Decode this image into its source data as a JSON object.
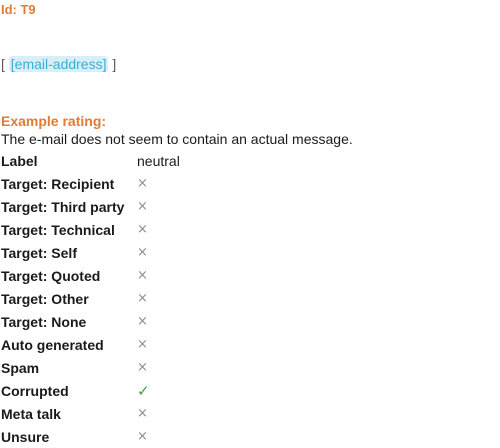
{
  "id_line": "Id: T9",
  "email": {
    "open": "[ ",
    "tag": "[email-address]",
    "close": " ]"
  },
  "example_title": "Example rating:",
  "description": "The e-mail does not seem to contain an actual message.",
  "label_row": {
    "key": "Label",
    "value": "neutral"
  },
  "symbols": {
    "no": "×",
    "yes": "✓"
  },
  "colors": {
    "orange": "#e07b39",
    "check": "#3f9f3f",
    "cross": "#8c8c8c",
    "email_bg": "#d9eff7",
    "email_text": "#3aaed8"
  },
  "rows": [
    {
      "key": "Target: Recipient",
      "mark": "×"
    },
    {
      "key": "Target: Third party",
      "mark": "×"
    },
    {
      "key": "Target: Technical",
      "mark": "×"
    },
    {
      "key": "Target: Self",
      "mark": "×"
    },
    {
      "key": "Target: Quoted",
      "mark": "×"
    },
    {
      "key": "Target: Other",
      "mark": "×"
    },
    {
      "key": "Target: None",
      "mark": "×"
    },
    {
      "key": "Auto generated",
      "mark": "×"
    },
    {
      "key": "Spam",
      "mark": "×"
    },
    {
      "key": "Corrupted",
      "mark": "✓"
    },
    {
      "key": "Meta talk",
      "mark": "×"
    },
    {
      "key": "Unsure",
      "mark": "×"
    }
  ]
}
